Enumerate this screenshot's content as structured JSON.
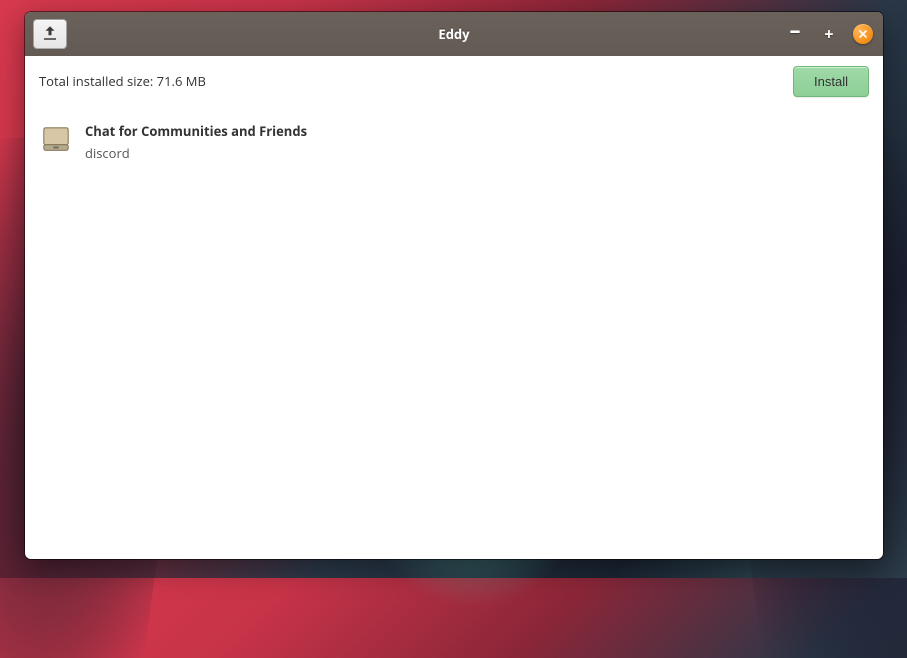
{
  "window": {
    "title": "Eddy"
  },
  "toolbar": {
    "size_label_prefix": "Total installed size: ",
    "size_value": "71.6 MB",
    "install_label": "Install"
  },
  "packages": [
    {
      "title": "Chat for Communities and Friends",
      "name": "discord",
      "icon": "package-icon"
    }
  ]
}
